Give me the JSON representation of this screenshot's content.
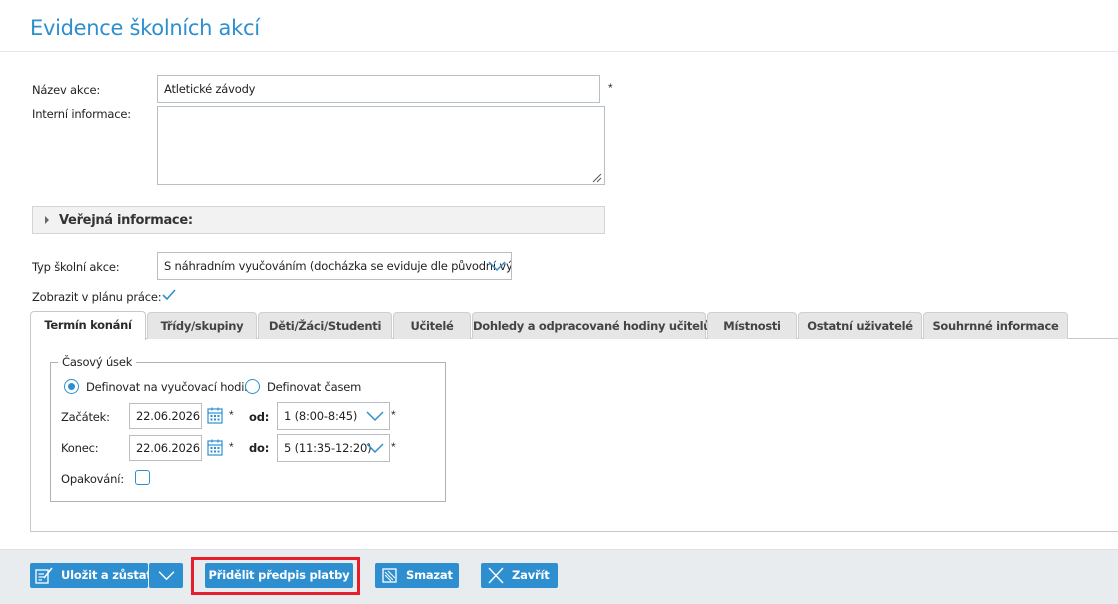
{
  "page": {
    "title": "Evidence školních akcí"
  },
  "form": {
    "name_label": "Název akce:",
    "name_value": "Atletické závody",
    "name_required": "*",
    "internal_label": "Interní informace:",
    "internal_value": "",
    "public_section_label": "Veřejná informace:",
    "type_label": "Typ školní akce:",
    "type_value": "S náhradním vyučováním (docházka se eviduje dle původní výuky)",
    "plan_label": "Zobrazit v plánu práce:",
    "plan_checked": true
  },
  "tabs": [
    {
      "label": "Termín konání",
      "active": true
    },
    {
      "label": "Třídy/skupiny"
    },
    {
      "label": "Děti/Žáci/Studenti"
    },
    {
      "label": "Učitelé"
    },
    {
      "label": "Dohledy a odpracované hodiny učitelů"
    },
    {
      "label": "Místnosti"
    },
    {
      "label": "Ostatní uživatelé"
    },
    {
      "label": "Souhrnné informace"
    }
  ],
  "term": {
    "legend": "Časový úsek",
    "radio_lessons": "Definovat na vyučovací hodiny",
    "radio_time": "Definovat časem",
    "selected_mode": "Definovat na vyučovací hodiny",
    "start_label": "Začátek:",
    "start_date": "22.06.2026",
    "end_label": "Konec:",
    "end_date": "22.06.2026",
    "from_label": "od:",
    "from_value": "1 (8:00-8:45)",
    "to_label": "do:",
    "to_value": "5 (11:35-12:20)",
    "repeat_label": "Opakování:",
    "required_mark": "*"
  },
  "footer": {
    "save_stay": "Uložit a zůstat",
    "assign_payment": "Přidělit předpis platby",
    "delete": "Smazat",
    "close": "Zavřít"
  },
  "colors": {
    "accent": "#2d8fd0",
    "highlight": "#e51e2a"
  },
  "icons": [
    "calendar-icon",
    "chevron-down-icon",
    "checkmark-icon",
    "save-icon",
    "delete-icon",
    "close-icon",
    "expand-arrow-icon"
  ]
}
